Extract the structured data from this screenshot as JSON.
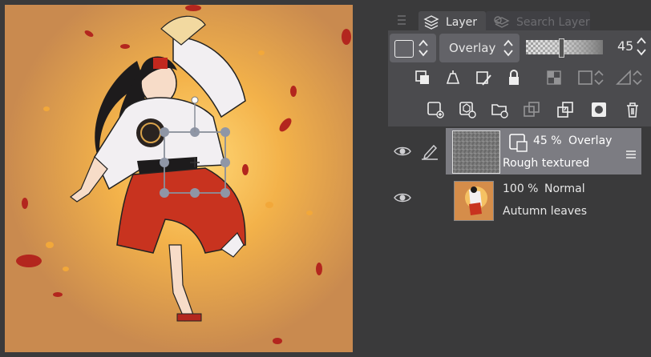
{
  "panel": {
    "menu_icon": "hamburger-menu-icon",
    "tabs": [
      {
        "label": "Layer",
        "icon": "layers-icon"
      },
      {
        "label": "Search Layer",
        "icon": "search-layer-icon"
      }
    ]
  },
  "blend": {
    "mode": "Overlay",
    "opacity_value": "45",
    "opacity_fraction": 0.45
  },
  "layers": [
    {
      "opacity": "45 %",
      "mode": "Overlay",
      "name": "Rough textured",
      "selected": true
    },
    {
      "opacity": "100 %",
      "mode": "Normal",
      "name": "Autumn leaves",
      "selected": false
    }
  ],
  "colors": {
    "panel_bg": "#3a3a3b",
    "toolbox_bg": "#4b4b4e",
    "selected_row": "#7c7c82",
    "canvas_orange": "#c98a4f"
  }
}
